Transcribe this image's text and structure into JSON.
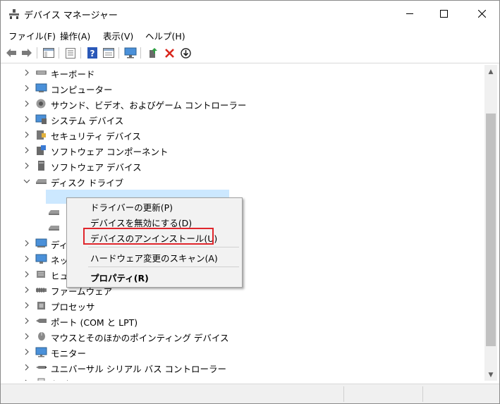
{
  "window": {
    "title": "デバイス マネージャー"
  },
  "window_controls": {
    "minimize": "—",
    "maximize": "☐",
    "close": "✕"
  },
  "menu": [
    "ファイル(F)",
    "操作(A)",
    "表示(V)",
    "ヘルプ(H)"
  ],
  "tree": [
    {
      "label": "キーボード",
      "icon": "keyboard-icon",
      "expanded": false
    },
    {
      "label": "コンピューター",
      "icon": "computer-icon",
      "expanded": false
    },
    {
      "label": "サウンド、ビデオ、およびゲーム コントローラー",
      "icon": "speaker-icon",
      "expanded": false
    },
    {
      "label": "システム デバイス",
      "icon": "system-device-icon",
      "expanded": false
    },
    {
      "label": "セキュリティ デバイス",
      "icon": "security-device-icon",
      "expanded": false
    },
    {
      "label": "ソフトウェア コンポーネント",
      "icon": "software-component-icon",
      "expanded": false
    },
    {
      "label": "ソフトウェア デバイス",
      "icon": "software-device-icon",
      "expanded": false
    },
    {
      "label": "ディスク ドライブ",
      "icon": "disk-drive-icon",
      "expanded": true
    },
    {
      "label": "",
      "icon": "disk-icon",
      "child": true
    },
    {
      "label": "",
      "icon": "disk-icon",
      "child": true
    },
    {
      "label": "",
      "icon": "disk-icon",
      "child": true
    },
    {
      "label": "ディ",
      "icon": "display-adapter-icon",
      "expanded": false
    },
    {
      "label": "ネッ",
      "icon": "network-adapter-icon",
      "expanded": false
    },
    {
      "label": "ヒュ",
      "icon": "hid-icon",
      "expanded": false
    },
    {
      "label": "ファームウェア",
      "icon": "firmware-icon",
      "expanded": false
    },
    {
      "label": "プロセッサ",
      "icon": "processor-icon",
      "expanded": false
    },
    {
      "label": "ポート (COM と LPT)",
      "icon": "port-icon",
      "expanded": false
    },
    {
      "label": "マウスとそのほかのポインティング デバイス",
      "icon": "mouse-icon",
      "expanded": false
    },
    {
      "label": "モニター",
      "icon": "monitor-icon",
      "expanded": false
    },
    {
      "label": "ユニバーサル シリアル バス コントローラー",
      "icon": "usb-icon",
      "expanded": false
    },
    {
      "label": "印刷キ",
      "icon": "printer-icon",
      "expanded": false
    }
  ],
  "context_menu": {
    "update_driver": "ドライバーの更新(P)",
    "disable_device": "デバイスを無効にする(D)",
    "uninstall_device": "デバイスのアンインストール(U)",
    "scan_hardware": "ハードウェア変更のスキャン(A)",
    "properties": "プロパティ(R)"
  },
  "colors": {
    "selection": "#cce8ff",
    "highlight_border": "#e0262c",
    "delete_red": "#d9261c"
  }
}
